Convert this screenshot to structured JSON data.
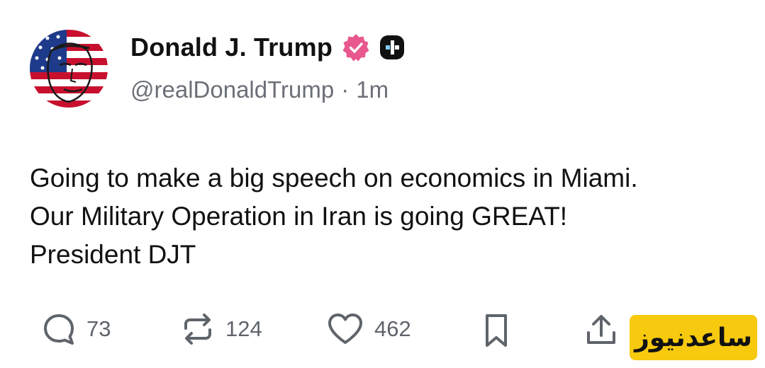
{
  "post": {
    "author": {
      "display_name": "Donald J. Trump",
      "handle": "@realDonaldTrump",
      "separator": "·",
      "time_ago": "1m",
      "avatar_icon": "flag-portrait-avatar",
      "verified_badge_color": "#e8578e",
      "plus_badge_color": "#111111"
    },
    "text": "Going to make a big speech on economics in Miami. Our Military Operation in Iran is going GREAT! President DJT"
  },
  "actions": {
    "reply": {
      "icon": "reply-icon",
      "count": "73"
    },
    "repost": {
      "icon": "repost-icon",
      "count": "124"
    },
    "like": {
      "icon": "heart-icon",
      "count": "462"
    },
    "bookmark": {
      "icon": "bookmark-icon"
    },
    "share": {
      "icon": "share-icon"
    }
  },
  "watermark": {
    "text": "ساعدنیوز",
    "color": "#f7c90f"
  }
}
